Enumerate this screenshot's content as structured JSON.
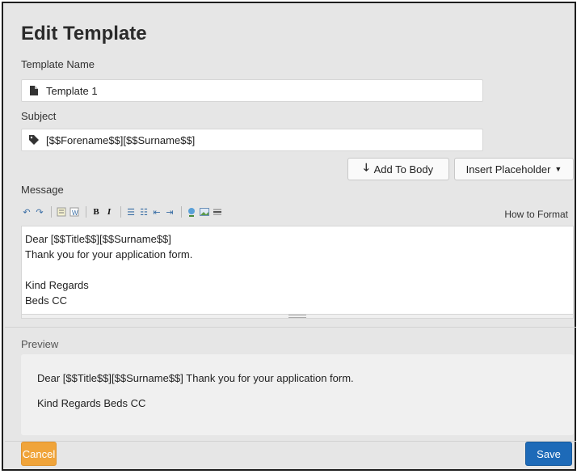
{
  "dialog": {
    "title": "Edit Template"
  },
  "template_name": {
    "label": "Template Name",
    "value": "Template 1",
    "icon": "document-icon"
  },
  "subject": {
    "label": "Subject",
    "value": "[$$Forename$$][$$Surname$$]",
    "icon": "tag-icon"
  },
  "actions": {
    "add_to_body": "Add To Body",
    "insert_placeholder": "Insert Placeholder"
  },
  "message": {
    "label": "Message",
    "how_to_format": "How to Format",
    "lines": [
      "Dear [$$Title$$][$$Surname$$]",
      "Thank you for your application form.",
      "",
      "Kind Regards",
      "Beds CC"
    ]
  },
  "toolbar": {
    "buttons": [
      "undo",
      "redo",
      "paste-text",
      "paste-word",
      "bold",
      "italic",
      "bullet-list",
      "numbered-list",
      "outdent",
      "indent",
      "link",
      "image",
      "horizontal-rule"
    ]
  },
  "preview": {
    "label": "Preview",
    "paragraph_1": "Dear [$$Title$$][$$Surname$$] Thank you for your application form.",
    "paragraph_2": "Kind Regards Beds CC"
  },
  "footer": {
    "cancel": "Cancel",
    "save": "Save"
  },
  "colors": {
    "cancel_bg": "#f0a43a",
    "save_bg": "#1d6ab8",
    "dialog_bg": "#e6e6e6"
  }
}
